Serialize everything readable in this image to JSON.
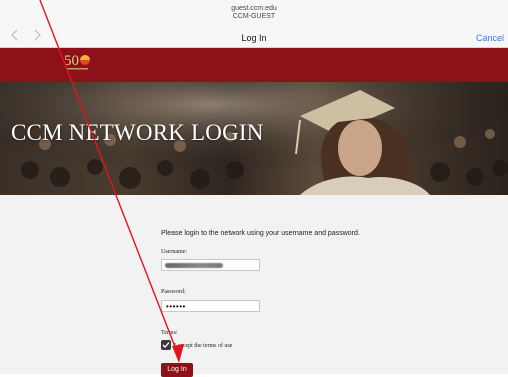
{
  "browser": {
    "host": "guest.ccm.edu",
    "ssid": "CCM-GUEST",
    "title": "Log In",
    "cancel_label": "Cancel",
    "back_icon": "chevron-left-icon",
    "forward_icon": "chevron-right-icon"
  },
  "banner": {
    "logo_text": "50",
    "hero_title": "CCM NETWORK LOGIN"
  },
  "form": {
    "intro": "Please login to the network using your username and password.",
    "username_label": "Username:",
    "password_label": "Password:",
    "password_value": "••••••",
    "terms_label": "Terms:",
    "terms_checkbox_label": "I accept the terms of use",
    "terms_checked": true,
    "submit_label": "Log In"
  },
  "colors": {
    "brand_red": "#8c1118",
    "link_blue": "#2e7cf6",
    "annotation_red": "#e2141c"
  }
}
